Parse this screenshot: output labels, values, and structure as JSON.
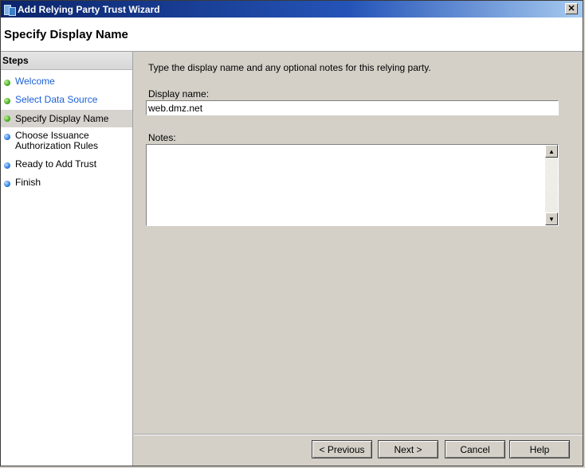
{
  "window": {
    "title": "Add Relying Party Trust Wizard",
    "close_glyph": "✕"
  },
  "header": {
    "title": "Specify Display Name"
  },
  "steps": {
    "heading": "Steps",
    "items": [
      {
        "label": "Welcome",
        "state": "done"
      },
      {
        "label": "Select Data Source",
        "state": "done"
      },
      {
        "label": "Specify Display Name",
        "state": "current"
      },
      {
        "label": "Choose Issuance Authorization Rules",
        "state": "pending"
      },
      {
        "label": "Ready to Add Trust",
        "state": "pending"
      },
      {
        "label": "Finish",
        "state": "pending"
      }
    ]
  },
  "main": {
    "instruction": "Type the display name and any optional notes for this relying party.",
    "display_name_label": "Display name:",
    "display_name_value": "web.dmz.net",
    "notes_label": "Notes:",
    "notes_value": ""
  },
  "footer": {
    "previous_label": "< Previous",
    "next_label": "Next >",
    "cancel_label": "Cancel",
    "help_label": "Help"
  },
  "colors": {
    "title_bar": "#0a246a",
    "link": "#1a5fd6",
    "done_dot": "#45b020",
    "pending_dot": "#2f7fe0"
  }
}
